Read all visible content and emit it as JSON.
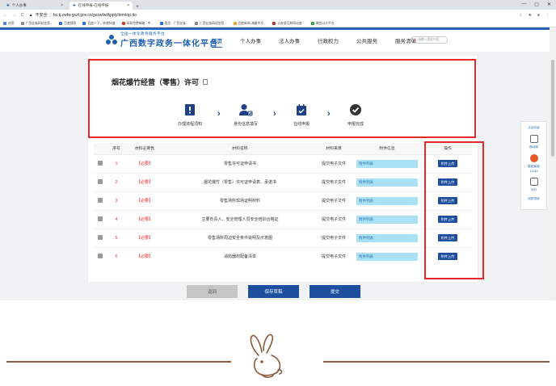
{
  "browser": {
    "tabs": [
      {
        "label": "个人办事",
        "active": false
      },
      {
        "label": "在线申报-在线申报",
        "active": true
      }
    ],
    "address": {
      "security": "不安全",
      "url": "hc.tj.zwfw.gxzf.gov.cn/gxzwfw/ApplyItemInp.do"
    },
    "bookmarks": [
      "应用",
      "广西壮族网站信息...",
      "百度搜索",
      "百度一下，你就知道",
      "网易免费邮箱 - 中...",
      "首页 - 广西壮族...",
      "广西壮族网站信息...",
      "百度新闻-海量中文...",
      "公安部互联网站查...",
      "微信公众平台"
    ],
    "window_controls": [
      "—",
      "▢",
      "✕"
    ]
  },
  "site": {
    "logo_sub": "全国一体化政务服务平台",
    "logo_main": "广西数字政务一体化平台",
    "nav": [
      "首页",
      "个人办事",
      "法人办事",
      "行政权力",
      "公共服务",
      "服务清单"
    ],
    "search_placeholder": "请输入搜索内容"
  },
  "page": {
    "title": "烟花爆竹经营（零售）许可",
    "steps": [
      "办理流程须知",
      "身份信息填写",
      "在线申报",
      "申报完成"
    ]
  },
  "table": {
    "headers": [
      "",
      "序号",
      "材料必要性",
      "材料名称",
      "材料来源",
      "附件信息",
      "操作"
    ],
    "rows": [
      {
        "no": "1",
        "req": "【必要】",
        "name": "零售许可证申请书",
        "source": "提交电子文件",
        "attach": "附件列表",
        "op": "附件上传"
      },
      {
        "no": "2",
        "req": "【必要】",
        "name": "烟花爆竹（零售）许可证申请表、承诺书",
        "source": "提交电子文件",
        "attach": "附件列表",
        "op": "附件上传"
      },
      {
        "no": "3",
        "req": "【必要】",
        "name": "零售场所现场证明材料",
        "source": "提交电子文件",
        "attach": "附件列表",
        "op": "附件上传"
      },
      {
        "no": "4",
        "req": "【必要】",
        "name": "主要负责人、安全管理人员安全培训合格证",
        "source": "提交电子文件",
        "attach": "附件列表",
        "op": "附件上传"
      },
      {
        "no": "5",
        "req": "【必要】",
        "name": "零售场所周边安全条件说明及示意图",
        "source": "提交电子文件",
        "attach": "附件列表",
        "op": "附件上传"
      },
      {
        "no": "6",
        "req": "【必要】",
        "name": "消防器材配备清单",
        "source": "提交电子文件",
        "attach": "附件列表",
        "op": "附件上传"
      }
    ]
  },
  "actions": {
    "back": "返回",
    "save": "保存草稿",
    "submit": "提交"
  },
  "sidebar": {
    "items": [
      "点此收起",
      "移动端",
      "智能客服",
      "12345",
      "评价",
      "回到顶部"
    ]
  },
  "colors": {
    "brand": "#1d5fb0",
    "highlight": "#e8262c",
    "button": "#1e4f9e",
    "decor": "#8b5a3c"
  }
}
